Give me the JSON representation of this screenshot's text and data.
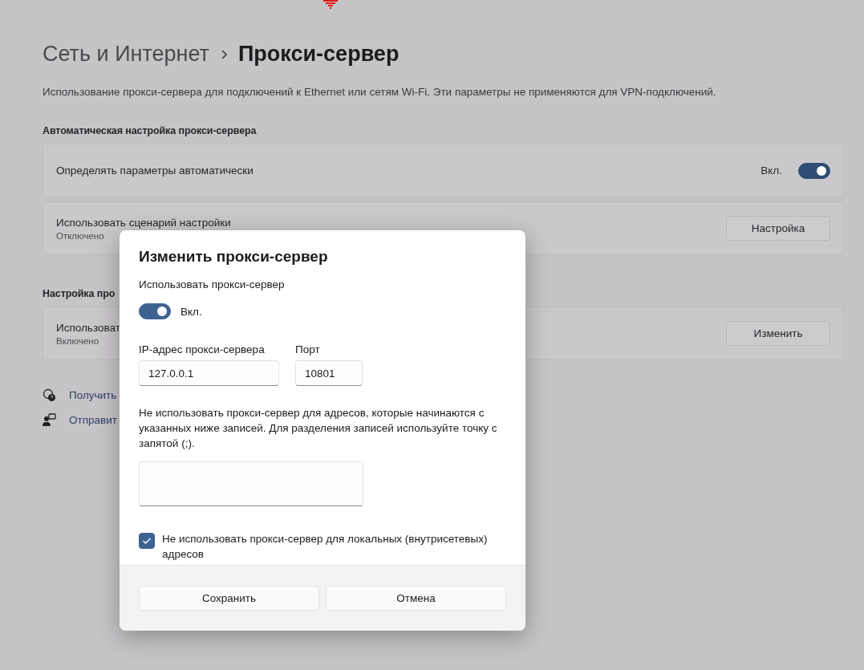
{
  "breadcrumb": {
    "parent": "Сеть и Интернет",
    "current": "Прокси-сервер"
  },
  "description": "Использование прокси-сервера для подключений к Ethernet или сетям Wi-Fi. Эти параметры не применяются для VPN-подключений.",
  "sections": [
    {
      "heading": "Автоматическая настройка прокси-сервера",
      "rows": [
        {
          "kind": "toggle",
          "label": "Определять параметры автоматически",
          "state_label": "Вкл.",
          "on": true
        },
        {
          "kind": "button",
          "label": "Использовать сценарий настройки",
          "sublabel": "Отключено",
          "button": "Настройка"
        }
      ]
    },
    {
      "heading": "Настройка про",
      "rows": [
        {
          "kind": "button",
          "label": "Использоват",
          "sublabel": "Включено",
          "button": "Изменить"
        }
      ]
    }
  ],
  "links": [
    "Получить",
    "Отправит"
  ],
  "dialog": {
    "title": "Изменить прокси-сервер",
    "use_proxy": {
      "label": "Использовать прокси-сервер",
      "on": true,
      "state_label": "Вкл."
    },
    "address": {
      "label": "IP-адрес прокси-сервера",
      "value": "127.0.0.1"
    },
    "port": {
      "label": "Порт",
      "value": "10801"
    },
    "exceptions_text": "Не использовать прокси-сервер для адресов, которые начинаются с указанных ниже записей. Для разделения записей используйте точку с запятой (;).",
    "local_bypass": {
      "label": "Не использовать прокси-сервер для локальных (внутрисетевых) адресов",
      "checked": true
    },
    "buttons": [
      "Сохранить",
      "Отмена"
    ]
  }
}
